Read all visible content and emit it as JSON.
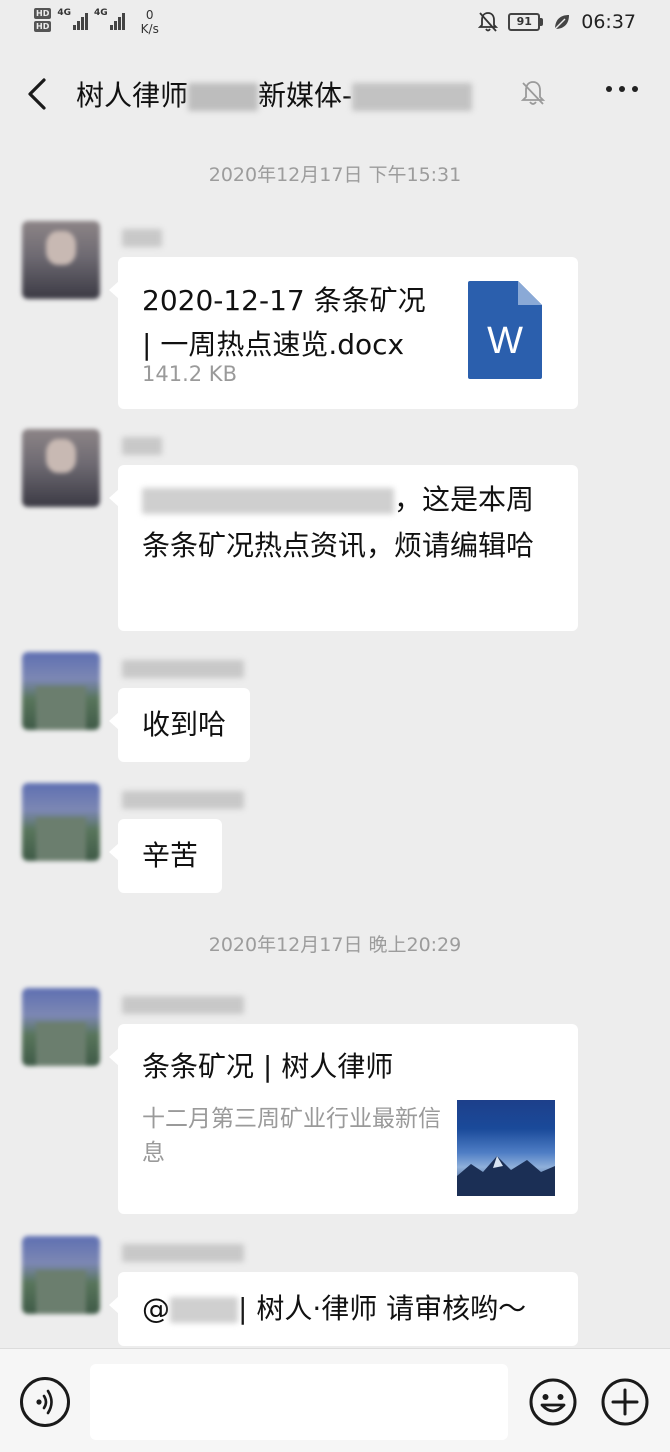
{
  "status_bar": {
    "hd1": "HD",
    "hd2": "HD",
    "net1": "4G",
    "net2": "4G",
    "speed_value": "0",
    "speed_unit": "K/s",
    "battery": "91",
    "time": "06:37"
  },
  "nav": {
    "title_part1": "树人律师",
    "title_part2": "新媒体-",
    "back_icon": "chevron-left-icon",
    "mute_icon": "bell-off-icon",
    "more_icon": "more-dots-icon"
  },
  "timestamps": [
    "2020年12月17日 下午15:31",
    "2020年12月17日 晚上20:29"
  ],
  "messages": {
    "file": {
      "name": "2020-12-17 条条矿况 | 一周热点速览.docx",
      "size": "141.2 KB",
      "icon_letter": "W",
      "icon_color": "#2b5fad"
    },
    "text1": {
      "text": "，这是本周条条矿况热点资讯，烦请编辑哈"
    },
    "text2": {
      "text": "收到哈"
    },
    "text3": {
      "text": "辛苦"
    },
    "article": {
      "title": "条条矿况 | 树人律师",
      "desc": "十二月第三周矿业行业最新信息"
    },
    "text4": {
      "prefix": "@",
      "suffix": "| 树人·律师 请审核哟～"
    }
  },
  "input_bar": {
    "voice_icon": "voice-icon",
    "emoji_icon": "emoji-icon",
    "plus_icon": "plus-icon",
    "input_value": ""
  },
  "colors": {
    "background": "#ededed",
    "bubble": "#ffffff",
    "timestamp_text": "#9c9c9c",
    "word_blue": "#2b5fad"
  }
}
